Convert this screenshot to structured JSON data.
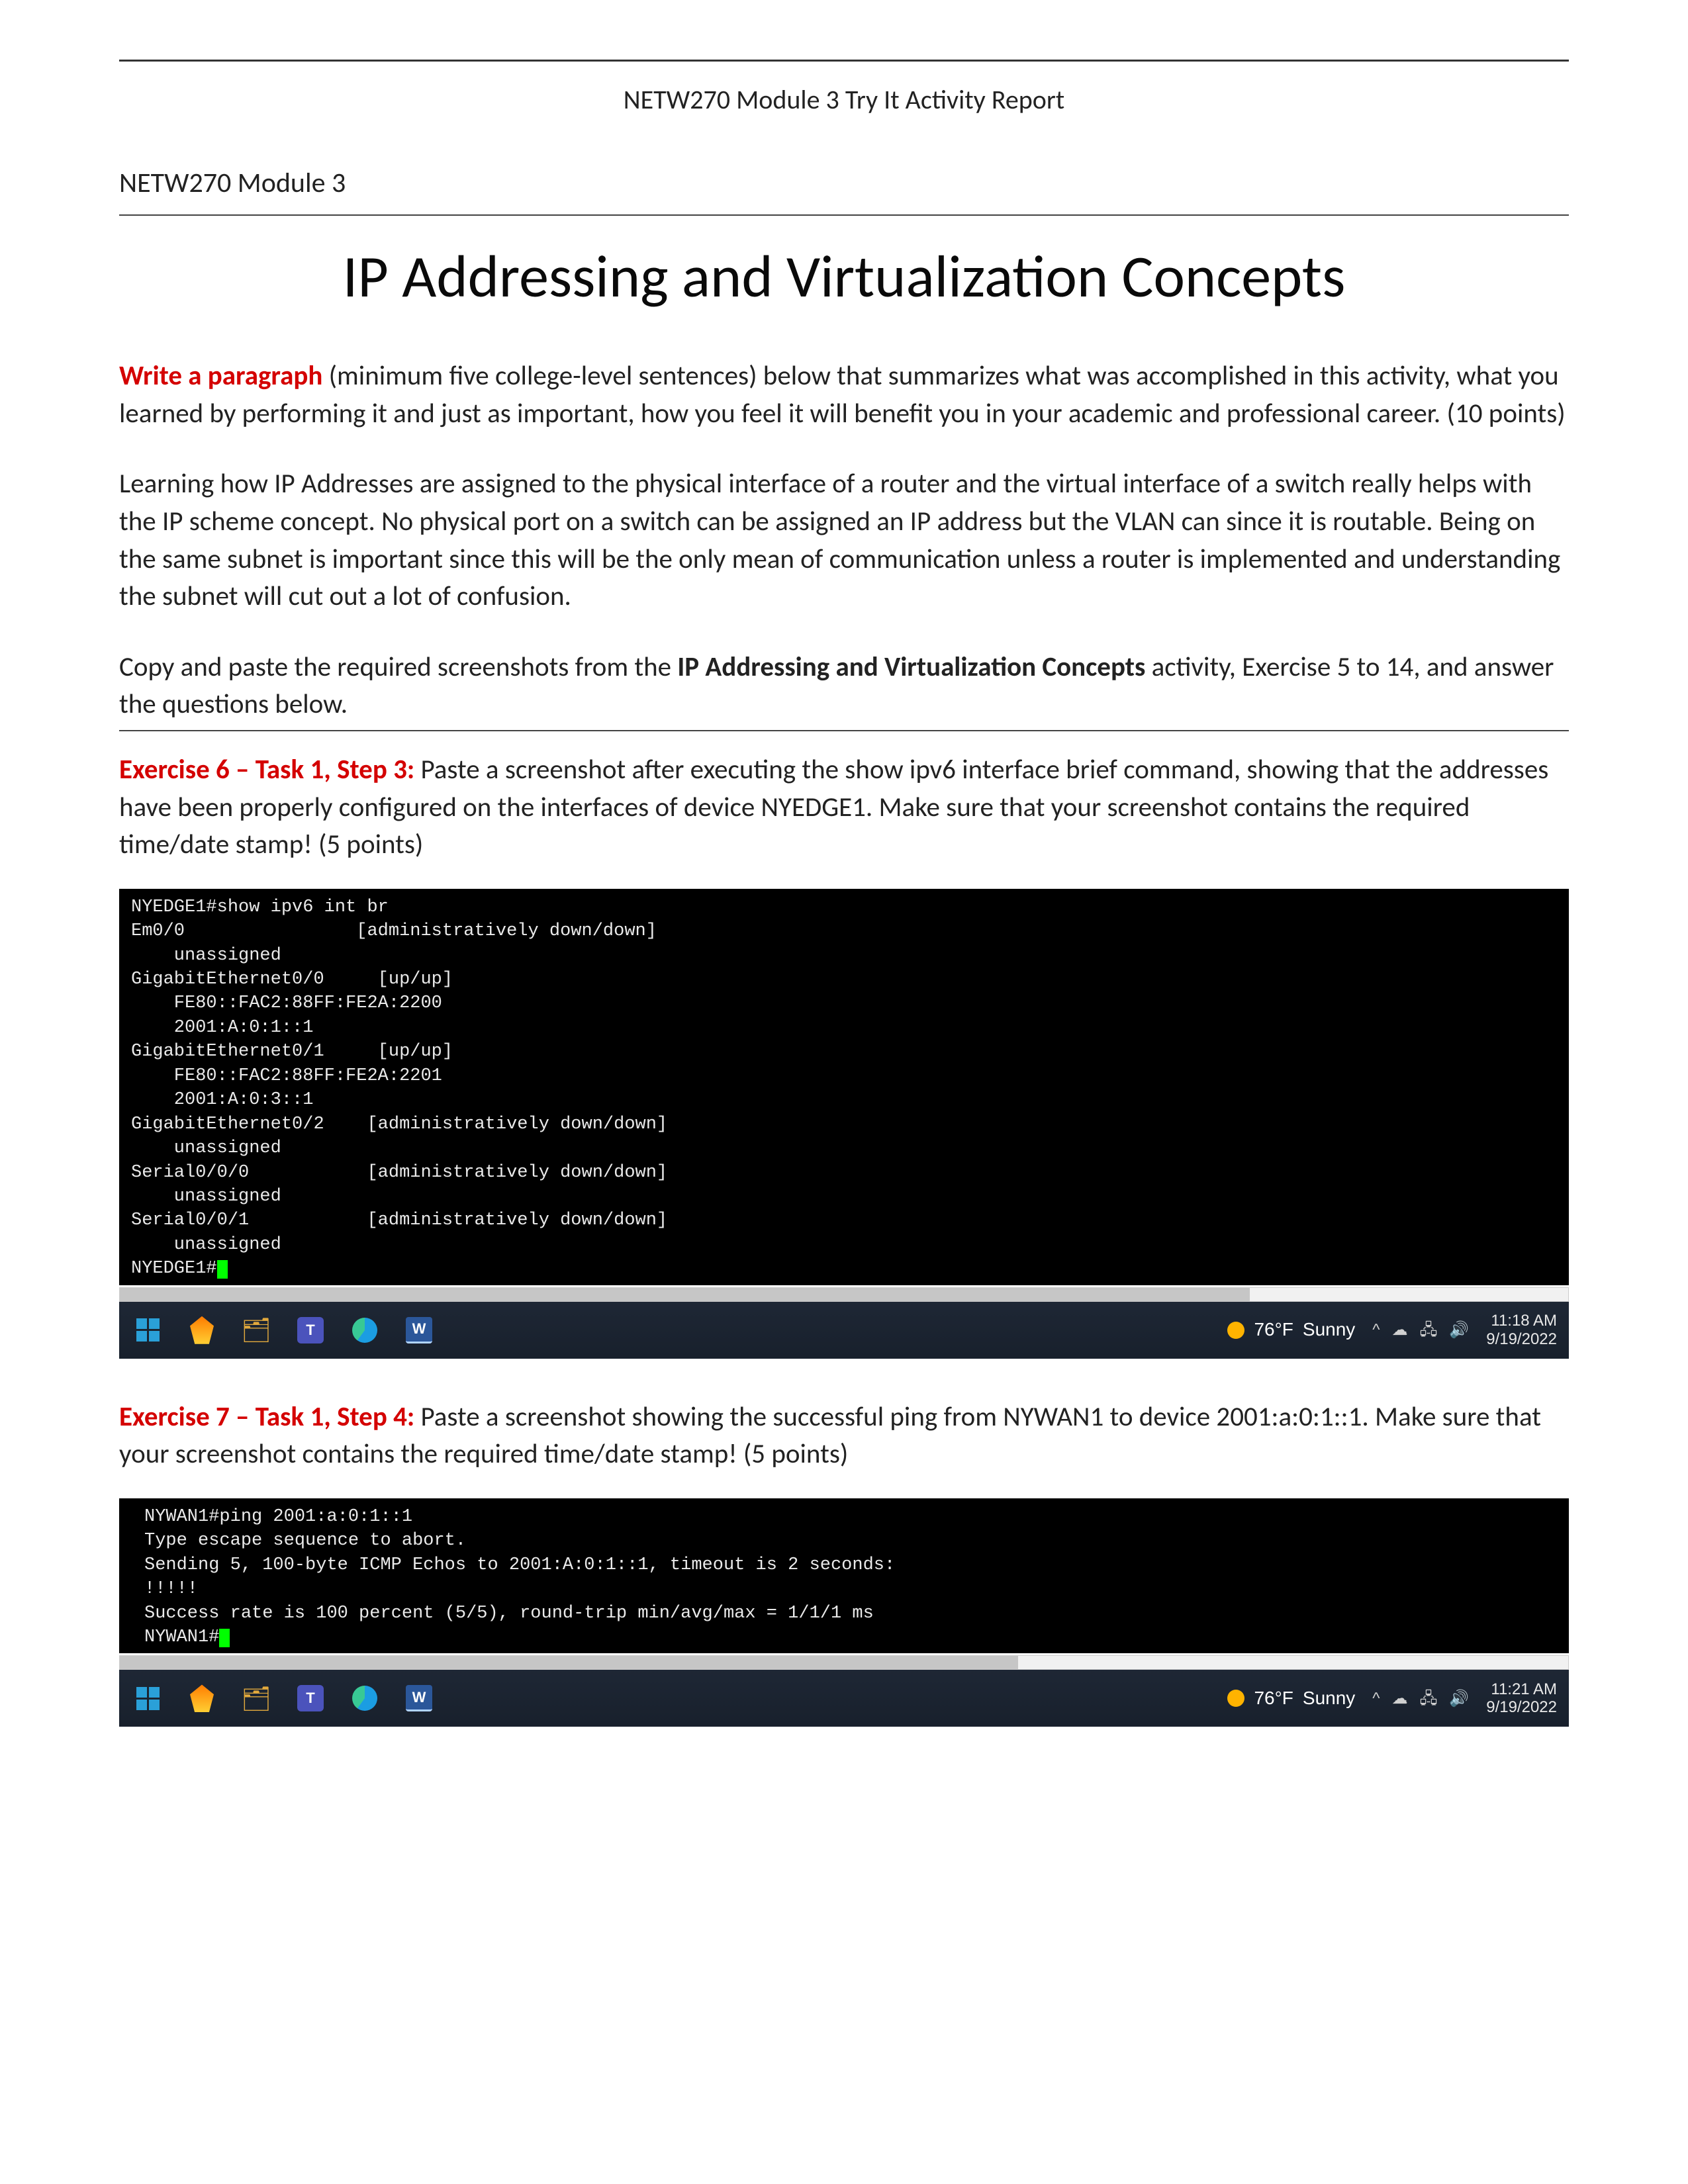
{
  "header": {
    "banner": "NETW270 Module 3 Try It Activity Report",
    "module_line": "NETW270 Module 3"
  },
  "title": "IP Addressing and Virtualization Concepts",
  "intro": {
    "label": "Write a paragraph",
    "text": " (minimum five college-level sentences) below that summarizes what was accomplished in this activity, what you learned by performing it and just as important, how you feel it will benefit you in your academic and professional career.   (10 points)"
  },
  "body_para": "Learning how IP Addresses are assigned to the physical interface of a router and the virtual interface of a switch really helps with the IP scheme concept. No physical port on a switch can be assigned an IP address but the VLAN can since it is routable. Being on the same subnet is important since this will be the only mean of communication unless a router is implemented and understanding the subnet will cut out a lot of confusion.",
  "copy_para": {
    "pre": "Copy and paste the required screenshots from the ",
    "bold": "IP Addressing and Virtualization Concepts",
    "post": " activity, Exercise 5 to 14, and answer the questions below."
  },
  "ex6": {
    "label": "Exercise 6 – Task 1, Step 3:",
    "text": " Paste a screenshot after executing the show ipv6 interface brief command, showing that the addresses have been properly configured on the interfaces of device NYEDGE1. Make sure that your screenshot contains the required time/date stamp!  (5 points)"
  },
  "terminal1": {
    "lines": [
      "NYEDGE1#show ipv6 int br",
      "Em0/0                [administratively down/down]",
      "    unassigned",
      "GigabitEthernet0/0     [up/up]",
      "    FE80::FAC2:88FF:FE2A:2200",
      "    2001:A:0:1::1",
      "GigabitEthernet0/1     [up/up]",
      "    FE80::FAC2:88FF:FE2A:2201",
      "    2001:A:0:3::1",
      "GigabitEthernet0/2    [administratively down/down]",
      "    unassigned",
      "Serial0/0/0           [administratively down/down]",
      "    unassigned",
      "Serial0/0/1           [administratively down/down]",
      "    unassigned",
      "NYEDGE1#"
    ]
  },
  "taskbar1": {
    "weather_temp": "76°F",
    "weather_cond": "Sunny",
    "time": "11:18 AM",
    "date": "9/19/2022"
  },
  "ex7": {
    "label": "Exercise 7 – Task 1, Step 4:",
    "text": " Paste a screenshot showing the successful ping from NYWAN1 to device 2001:a:0:1::1. Make sure that your screenshot contains the required time/date stamp!  (5 points)"
  },
  "terminal2": {
    "lines": [
      "NYWAN1#ping 2001:a:0:1::1",
      "Type escape sequence to abort.",
      "Sending 5, 100-byte ICMP Echos to 2001:A:0:1::1, timeout is 2 seconds:",
      "!!!!!",
      "Success rate is 100 percent (5/5), round-trip min/avg/max = 1/1/1 ms",
      "NYWAN1#"
    ]
  },
  "taskbar2": {
    "weather_temp": "76°F",
    "weather_cond": "Sunny",
    "time": "11:21 AM",
    "date": "9/19/2022"
  },
  "icons": {
    "start": "start-button",
    "power": "power-icon",
    "folder": "file-explorer-icon",
    "teams": "teams-icon",
    "edge": "edge-icon",
    "word": "word-icon",
    "chevron": "^",
    "cloud": "☁",
    "net": "🖧",
    "vol": "🔊"
  }
}
